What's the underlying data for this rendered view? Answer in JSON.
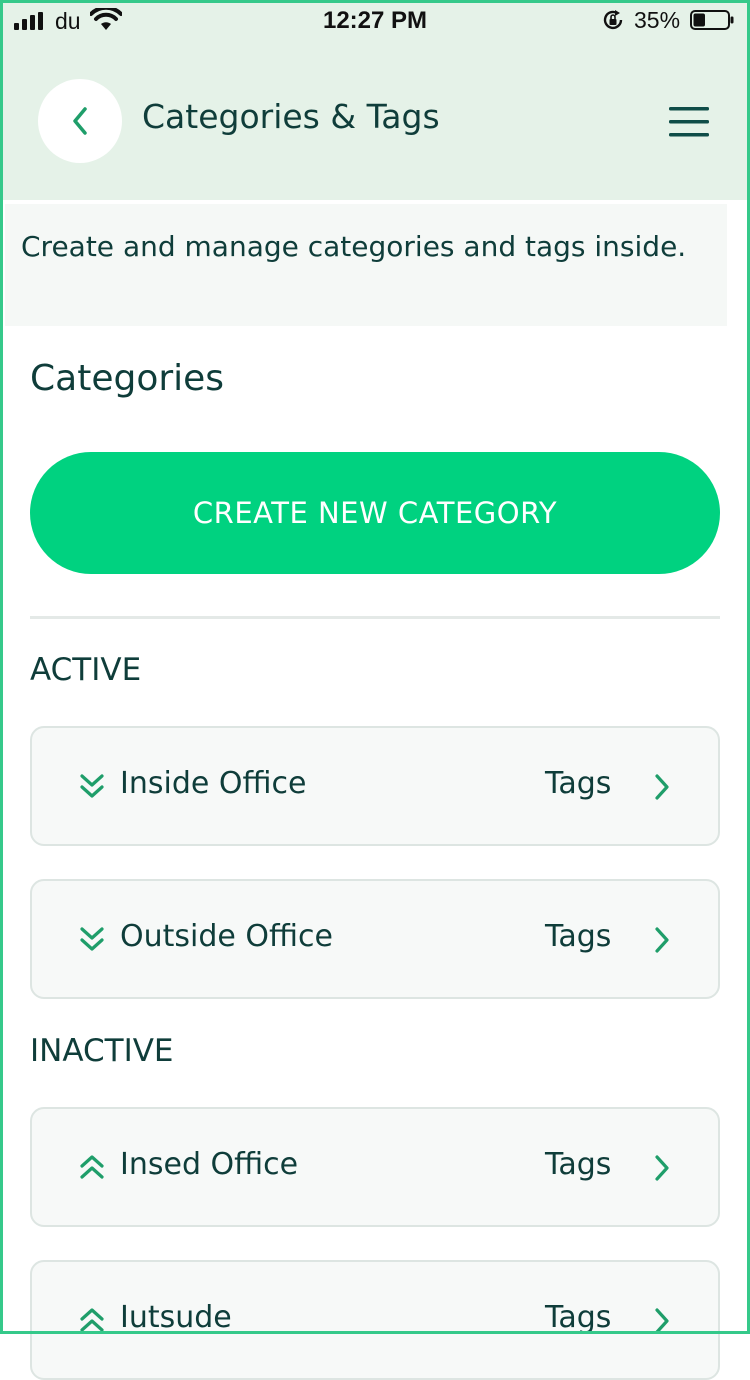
{
  "status_bar": {
    "carrier": "du",
    "time": "12:27 PM",
    "battery_percent": "35%",
    "battery_level": 0.35,
    "icons": [
      "signal-icon",
      "wifi-icon",
      "rotation-lock-icon",
      "battery-icon"
    ]
  },
  "header": {
    "title": "Categories & Tags",
    "back_icon": "chevron-left-icon",
    "menu_icon": "hamburger-menu-icon"
  },
  "intro": {
    "text": "Create and manage categories and tags inside."
  },
  "categories": {
    "title": "Categories",
    "create_button_label": "CREATE NEW CATEGORY",
    "groups": [
      {
        "label": "ACTIVE",
        "items": [
          {
            "name": "Inside Office",
            "tags_label": "Tags",
            "icon": "double-chevron-down-icon"
          },
          {
            "name": "Outside Office",
            "tags_label": "Tags",
            "icon": "double-chevron-down-icon"
          }
        ]
      },
      {
        "label": "INACTIVE",
        "items": [
          {
            "name": "Insed Office",
            "tags_label": "Tags",
            "icon": "double-chevron-up-icon"
          },
          {
            "name": "Iutsude",
            "tags_label": "Tags",
            "icon": "double-chevron-up-icon"
          }
        ]
      }
    ]
  },
  "colors": {
    "accent": "#00d280",
    "header_bg": "#e5f2e8",
    "text": "#0f3d3a",
    "icon_green": "#1f9e6a"
  }
}
